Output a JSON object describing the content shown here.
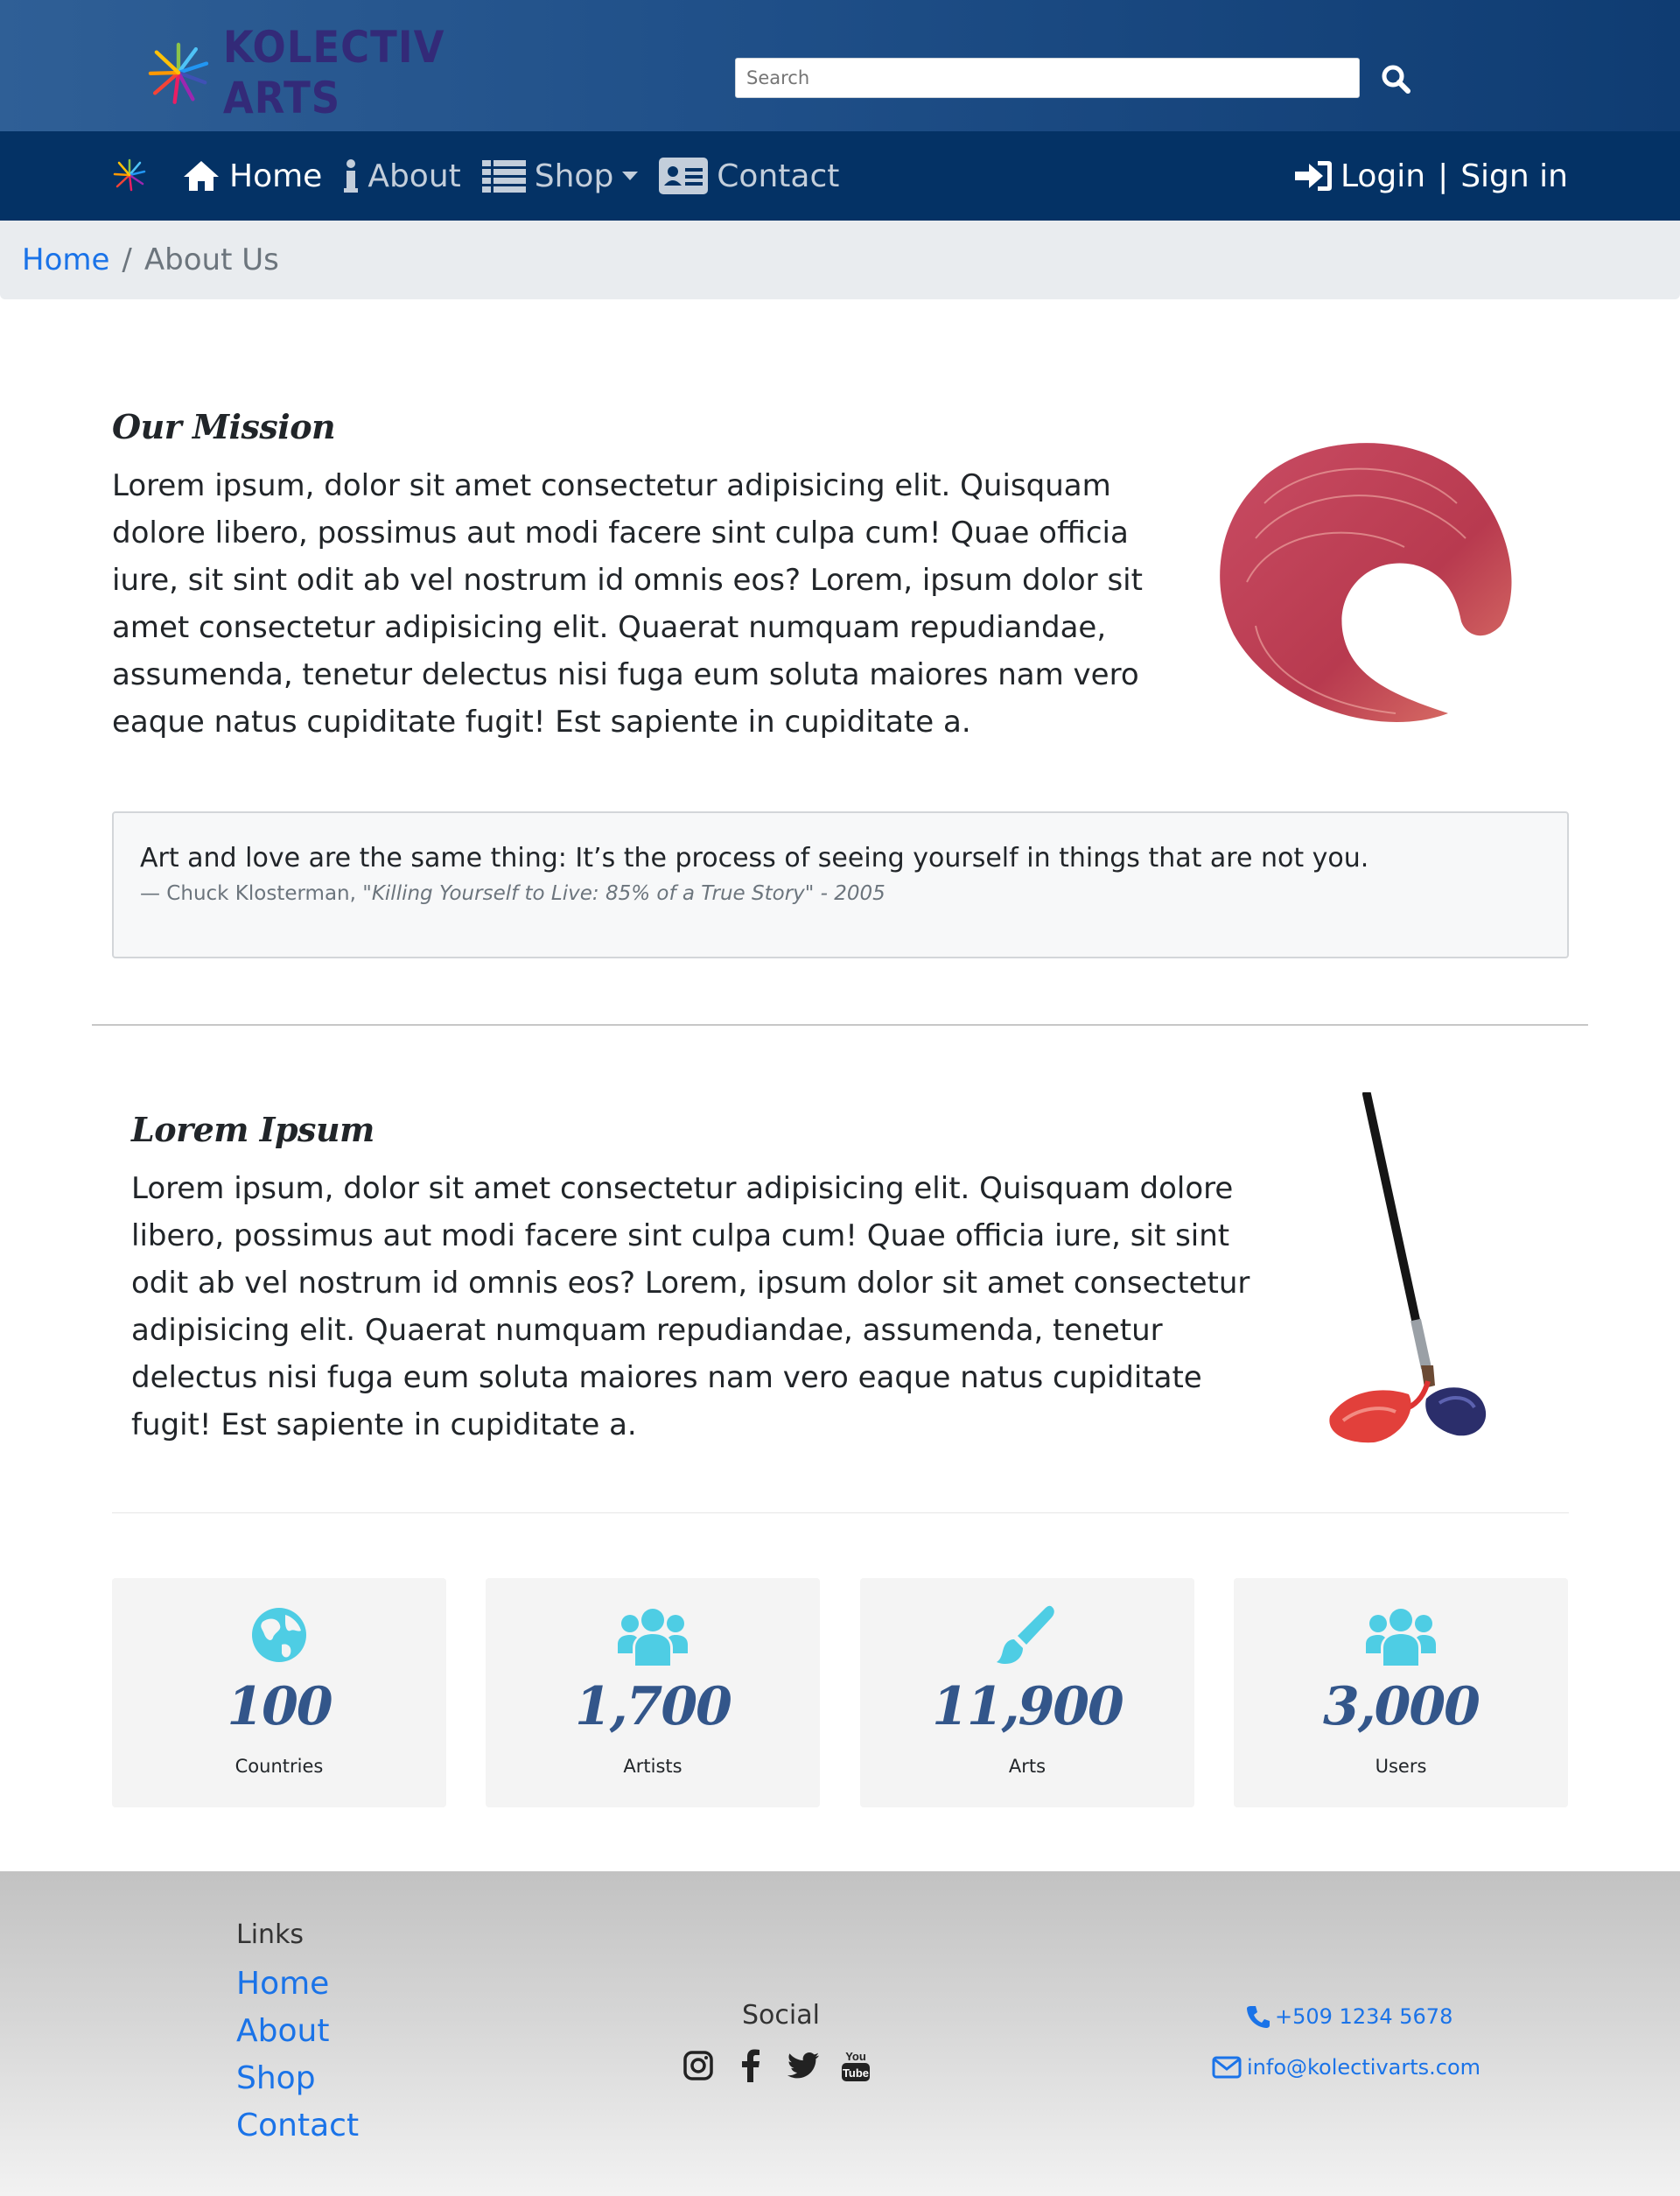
{
  "brand": {
    "name": "KOLECTIV ARTS"
  },
  "search": {
    "placeholder": "Search"
  },
  "nav": {
    "items": [
      {
        "label": "Home",
        "icon": "home-icon",
        "active": true
      },
      {
        "label": "About",
        "icon": "info-icon",
        "active": false
      },
      {
        "label": "Shop",
        "icon": "list-icon",
        "active": false
      },
      {
        "label": "Contact",
        "icon": "contact-card-icon",
        "active": false
      }
    ],
    "login_label": "Login",
    "separator": "|",
    "signin_label": "Sign in"
  },
  "breadcrumb": {
    "home": "Home",
    "separator": "/",
    "current": "About Us"
  },
  "mission": {
    "title": "Our Mission",
    "text": "Lorem ipsum, dolor sit amet consectetur adipisicing elit. Quisquam dolore libero, possimus aut modi facere sint culpa cum! Quae officia iure, sit sint odit ab vel nostrum id omnis eos? Lorem, ipsum dolor sit amet consectetur adipisicing elit. Quaerat numquam repudiandae, assumenda, tenetur delectus nisi fuga eum soluta maiores nam vero eaque natus cupiditate fugit! Est sapiente in cupiditate a."
  },
  "quote": {
    "text": "Art and love are the same thing: It’s the process of seeing yourself in things that are not you.",
    "author": "— Chuck Klosterman,",
    "source": "\"Killing Yourself to Live: 85% of a True Story\" - 2005"
  },
  "lorem": {
    "title": "Lorem Ipsum",
    "text": "Lorem ipsum, dolor sit amet consectetur adipisicing elit. Quisquam dolore libero, possimus aut modi facere sint culpa cum! Quae officia iure, sit sint odit ab vel nostrum id omnis eos? Lorem, ipsum dolor sit amet consectetur adipisicing elit. Quaerat numquam repudiandae, assumenda, tenetur delectus nisi fuga eum soluta maiores nam vero eaque natus cupiditate fugit! Est sapiente in cupiditate a."
  },
  "stats": [
    {
      "value": "100",
      "label": "Countries",
      "icon": "globe-icon"
    },
    {
      "value": "1,700",
      "label": "Artists",
      "icon": "users-icon"
    },
    {
      "value": "11,900",
      "label": "Arts",
      "icon": "paint-brush-icon"
    },
    {
      "value": "3,000",
      "label": "Users",
      "icon": "users-icon"
    }
  ],
  "footer": {
    "links_title": "Links",
    "links": [
      "Home",
      "About",
      "Shop",
      "Contact"
    ],
    "social_title": "Social",
    "social": [
      "instagram-icon",
      "facebook-icon",
      "twitter-icon",
      "youtube-icon"
    ],
    "phone": "+509 1234 5678",
    "email": "info@kolectivarts.com"
  },
  "colors": {
    "header": "#1f4f88",
    "nav": "#043265",
    "link": "#1a73e8",
    "stat_value": "#33568a",
    "stat_icon": "#4ecde4",
    "brand_text": "#332a78"
  }
}
